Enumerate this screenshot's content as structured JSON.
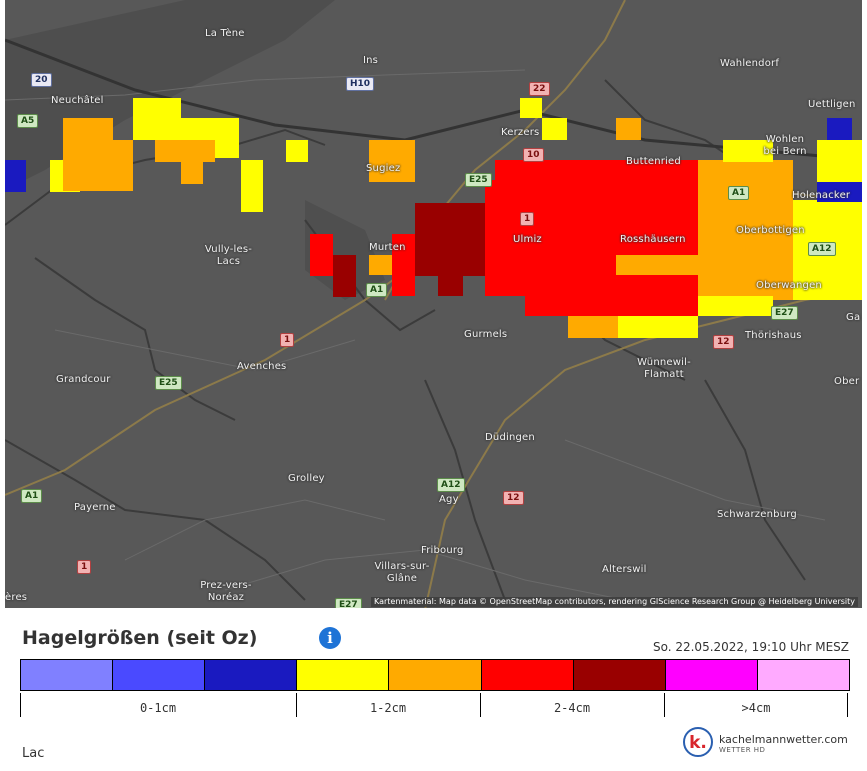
{
  "map": {
    "attribution": "Kartenmaterial: Map data © OpenStreetMap contributors, rendering GIScience Research Group @ Heidelberg University",
    "places": [
      "La Tène",
      "Wahlendorf",
      "Ins",
      "Neuchâtel",
      "Uettligen",
      "Kerzers",
      "Wohlen bei Bern",
      "Buttenried",
      "Sugiez",
      "Holenacker",
      "Ulmiz",
      "Rosshäusern",
      "Oberbottigen",
      "Vully-les-Lacs",
      "Murten",
      "Oberwangen",
      "Gurmels",
      "Thörishaus",
      "Wünnewil-Flamatt",
      "Grandcour",
      "Avenches",
      "Düdingen",
      "Grolley",
      "Payerne",
      "Agy",
      "Schwarzenburg",
      "Fribourg",
      "Villars-sur-Glâne",
      "Alterswil",
      "Prez-vers-Noréaz",
      "ères",
      "Ga",
      "Ober"
    ],
    "road_shields": [
      {
        "label": "20",
        "style": "white"
      },
      {
        "label": "A5",
        "style": "green"
      },
      {
        "label": "H10",
        "style": "white"
      },
      {
        "label": "22",
        "style": "red"
      },
      {
        "label": "10",
        "style": "red"
      },
      {
        "label": "E25",
        "style": "green"
      },
      {
        "label": "A1",
        "style": "green"
      },
      {
        "label": "1",
        "style": "red"
      },
      {
        "label": "A12",
        "style": "green"
      },
      {
        "label": "A1",
        "style": "green"
      },
      {
        "label": "E27",
        "style": "green"
      },
      {
        "label": "1",
        "style": "red"
      },
      {
        "label": "12",
        "style": "red"
      },
      {
        "label": "E25",
        "style": "green"
      },
      {
        "label": "A12",
        "style": "green"
      },
      {
        "label": "12",
        "style": "red"
      },
      {
        "label": "A1",
        "style": "green"
      },
      {
        "label": "1",
        "style": "red"
      },
      {
        "label": "E27",
        "style": "green"
      }
    ]
  },
  "legend": {
    "title": "Hagelgrößen (seit Oz)",
    "info_icon": "info-icon",
    "timestamp": "So. 22.05.2022, 19:10 Uhr MESZ",
    "colors": [
      "#8080ff",
      "#4a4aff",
      "#1a1ac0",
      "#ffff00",
      "#ffaa00",
      "#ff0000",
      "#990000",
      "#ff00ff",
      "#ffaaff"
    ],
    "ranges": [
      {
        "label": "0-1cm"
      },
      {
        "label": "1-2cm"
      },
      {
        "label": "2-4cm"
      },
      {
        "label": ">4cm"
      }
    ]
  },
  "region_label": "Lac",
  "brand": {
    "logo_text": "k.",
    "name": "kachelmannwetter.com",
    "sub": "WETTER HD"
  }
}
